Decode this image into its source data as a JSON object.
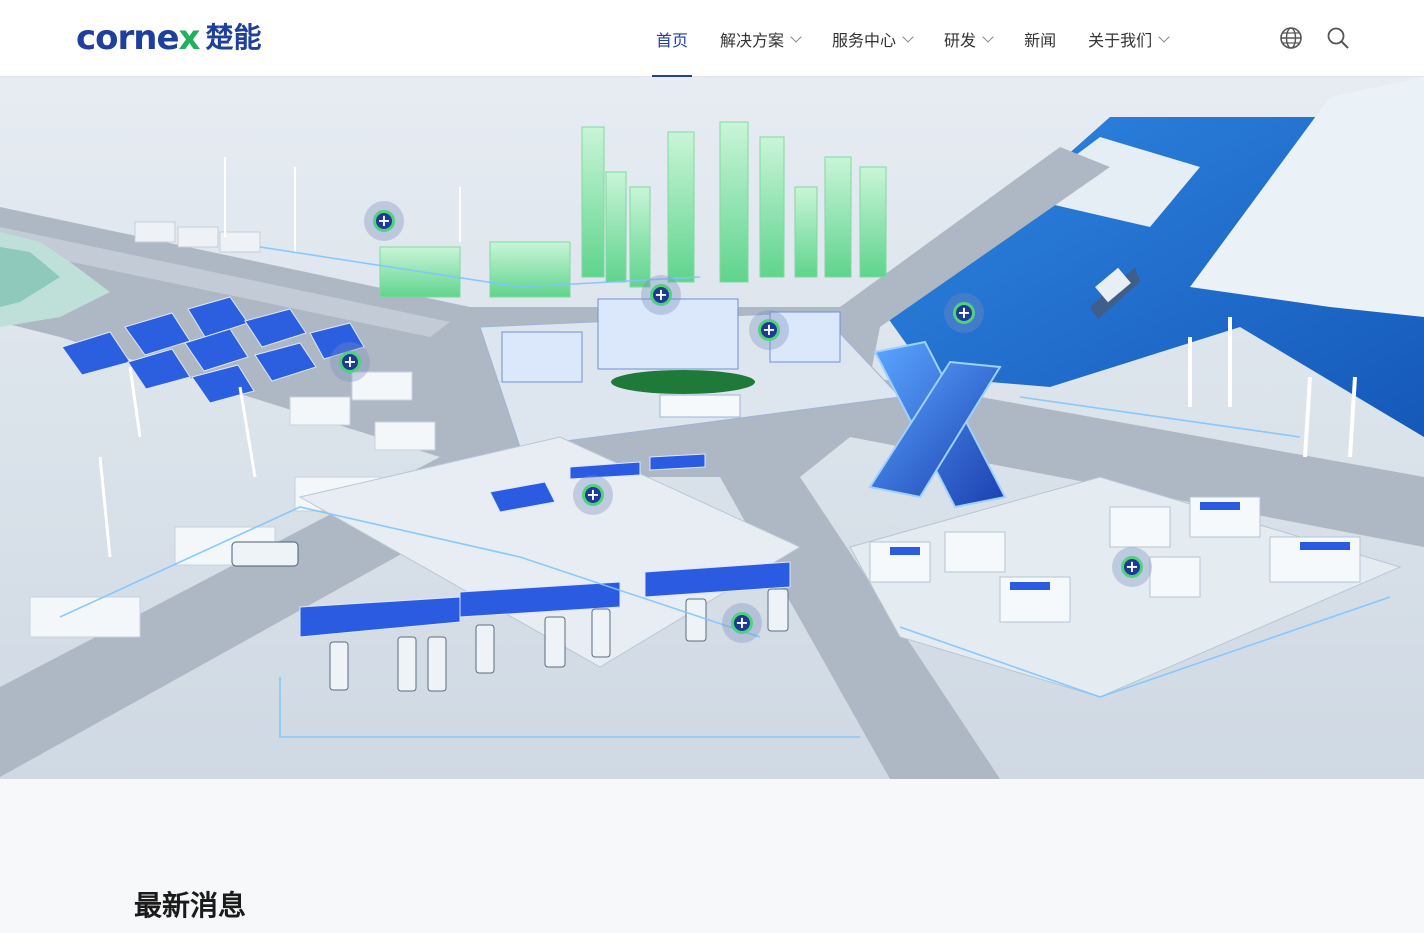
{
  "header": {
    "logo_word_a": "corne",
    "logo_word_x": "x",
    "logo_cn": "楚能",
    "nav": [
      {
        "label": "首页",
        "active": true,
        "has_dropdown": false
      },
      {
        "label": "解决方案",
        "active": false,
        "has_dropdown": true
      },
      {
        "label": "服务中心",
        "active": false,
        "has_dropdown": true
      },
      {
        "label": "研发",
        "active": false,
        "has_dropdown": true
      },
      {
        "label": "新闻",
        "active": false,
        "has_dropdown": false
      },
      {
        "label": "关于我们",
        "active": false,
        "has_dropdown": true
      }
    ],
    "icons": [
      "globe-icon",
      "search-icon"
    ]
  },
  "hero": {
    "hotspot_icon": "plus-icon",
    "hotspot_symbol": "+"
  },
  "news": {
    "title": "最新消息"
  },
  "colors": {
    "brand_blue": "#1f3f9d",
    "brand_green": "#22b15a",
    "water_blue": "#1c6fd1",
    "panel_blue": "#2457d6"
  }
}
